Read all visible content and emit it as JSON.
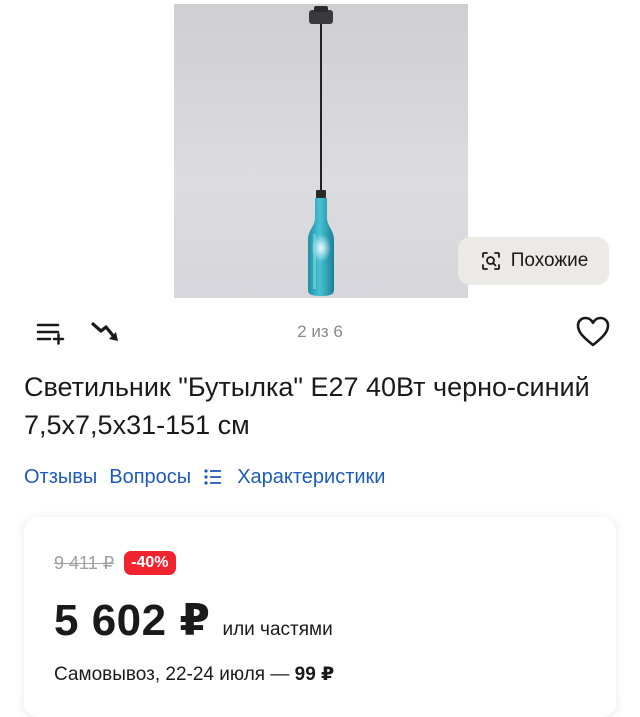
{
  "gallery": {
    "similar_label": "Похожие",
    "counter": "2 из 6"
  },
  "product": {
    "title": "Светильник \"Бутылка\" E27 40Вт черно-синий 7,5х7,5х31-151 см"
  },
  "links": {
    "reviews": "Отзывы",
    "questions": "Вопросы",
    "specs": "Характеристики"
  },
  "price": {
    "old": "9 411 ₽",
    "discount": "-40%",
    "current": "5 602 ₽",
    "installments": "или частями"
  },
  "delivery": {
    "text": "Самовывоз, 22-24 июля — ",
    "cost": "99 ₽"
  },
  "colors": {
    "link": "#1e5bbd",
    "discount_badge": "#f0232f",
    "bottle_glass": "#2aa6b8"
  }
}
